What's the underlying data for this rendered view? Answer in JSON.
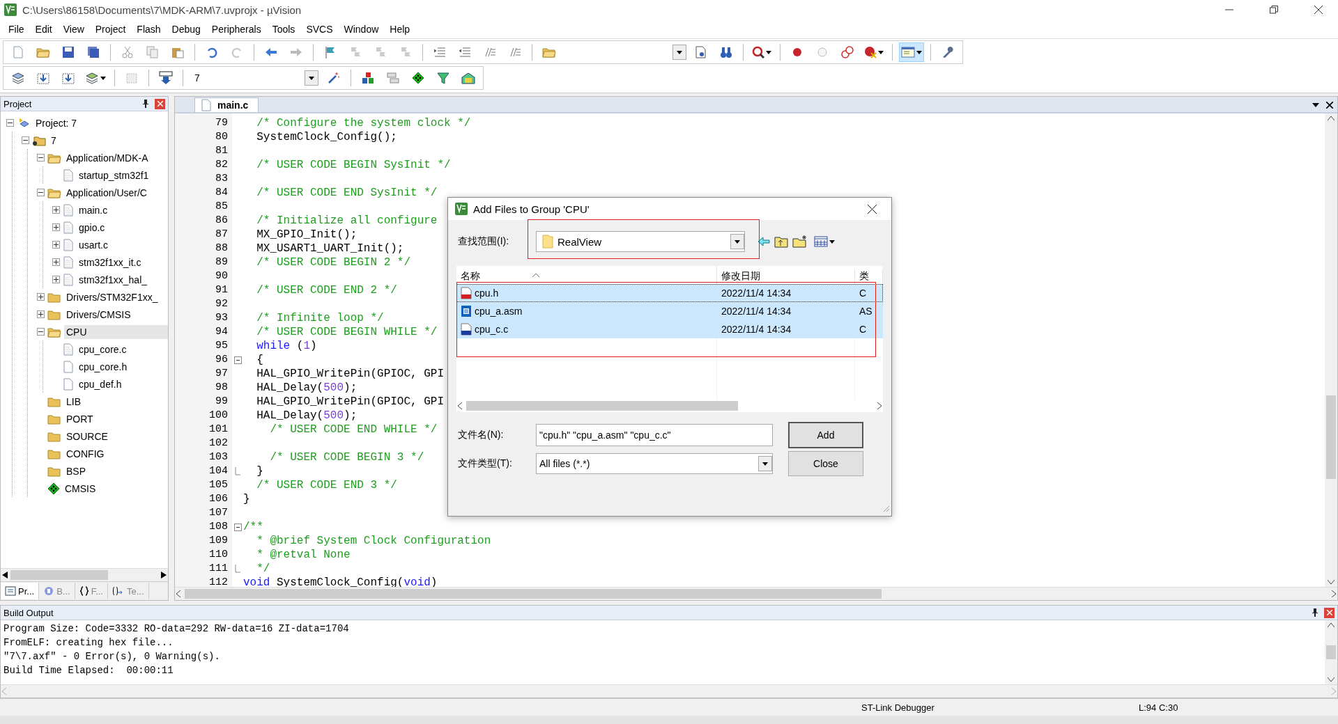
{
  "window": {
    "title": "C:\\Users\\86158\\Documents\\7\\MDK-ARM\\7.uvprojx - µVision"
  },
  "menu": [
    "File",
    "Edit",
    "View",
    "Project",
    "Flash",
    "Debug",
    "Peripherals",
    "Tools",
    "SVCS",
    "Window",
    "Help"
  ],
  "toolbar": {
    "window_toggle": {
      "selected": true
    },
    "target": {
      "value": "7"
    }
  },
  "project_panel": {
    "title": "Project",
    "tree": [
      {
        "label": "Project: 7",
        "kind": "project",
        "expanded": true,
        "selected": false,
        "children": [
          {
            "label": "7",
            "kind": "target",
            "expanded": true,
            "selected": false,
            "children": [
              {
                "label": "Application/MDK-A",
                "kind": "folder",
                "expanded": true,
                "selected": false,
                "children": [
                  {
                    "label": "startup_stm32f1",
                    "kind": "source",
                    "selected": false
                  }
                ]
              },
              {
                "label": "Application/User/C",
                "kind": "folder",
                "expanded": true,
                "selected": false,
                "children": [
                  {
                    "label": "main.c",
                    "kind": "source",
                    "expanded": false,
                    "selected": false
                  },
                  {
                    "label": "gpio.c",
                    "kind": "source",
                    "expanded": false,
                    "selected": false
                  },
                  {
                    "label": "usart.c",
                    "kind": "source",
                    "expanded": false,
                    "selected": false
                  },
                  {
                    "label": "stm32f1xx_it.c",
                    "kind": "source",
                    "expanded": false,
                    "selected": false
                  },
                  {
                    "label": "stm32f1xx_hal_",
                    "kind": "source",
                    "expanded": false,
                    "selected": false
                  }
                ]
              },
              {
                "label": "Drivers/STM32F1xx_",
                "kind": "folder",
                "expanded": false,
                "selected": false
              },
              {
                "label": "Drivers/CMSIS",
                "kind": "folder",
                "expanded": false,
                "selected": false
              },
              {
                "label": "CPU",
                "kind": "folder",
                "expanded": true,
                "selected": true,
                "children": [
                  {
                    "label": "cpu_core.c",
                    "kind": "source",
                    "selected": false
                  },
                  {
                    "label": "cpu_core.h",
                    "kind": "header",
                    "selected": false
                  },
                  {
                    "label": "cpu_def.h",
                    "kind": "header",
                    "selected": false
                  }
                ]
              },
              {
                "label": "LIB",
                "kind": "folder",
                "selected": false
              },
              {
                "label": "PORT",
                "kind": "folder",
                "selected": false
              },
              {
                "label": "SOURCE",
                "kind": "folder",
                "selected": false
              },
              {
                "label": "CONFIG",
                "kind": "folder",
                "selected": false
              },
              {
                "label": "BSP",
                "kind": "folder",
                "selected": false
              },
              {
                "label": "CMSIS",
                "kind": "component",
                "selected": false
              }
            ]
          }
        ]
      }
    ],
    "tabs": [
      {
        "label": "Pr...",
        "kind": "project",
        "selected": true
      },
      {
        "label": "B...",
        "kind": "books",
        "selected": false
      },
      {
        "label": "F...",
        "kind": "functions",
        "selected": false
      },
      {
        "label": "Te...",
        "kind": "templates",
        "selected": false
      }
    ]
  },
  "editor": {
    "tabs": [
      {
        "label": "main.c",
        "selected": true
      }
    ],
    "lines": [
      {
        "number": "79",
        "tokens": [
          {
            "kind": "comment",
            "text": "  /* Configure the system clock */"
          }
        ]
      },
      {
        "number": "80",
        "tokens": [
          {
            "kind": "code",
            "text": "  SystemClock_Config();"
          }
        ]
      },
      {
        "number": "81"
      },
      {
        "number": "82",
        "tokens": [
          {
            "kind": "comment",
            "text": "  /* USER CODE BEGIN SysInit */"
          }
        ]
      },
      {
        "number": "83"
      },
      {
        "number": "84",
        "tokens": [
          {
            "kind": "comment",
            "text": "  /* USER CODE END SysInit */"
          }
        ]
      },
      {
        "number": "85"
      },
      {
        "number": "86",
        "tokens": [
          {
            "kind": "comment",
            "text": "  /* Initialize all configure"
          }
        ]
      },
      {
        "number": "87",
        "tokens": [
          {
            "kind": "code",
            "text": "  MX_GPIO_Init();"
          }
        ]
      },
      {
        "number": "88",
        "tokens": [
          {
            "kind": "code",
            "text": "  MX_USART1_UART_Init();"
          }
        ]
      },
      {
        "number": "89",
        "tokens": [
          {
            "kind": "comment",
            "text": "  /* USER CODE BEGIN 2 */"
          }
        ]
      },
      {
        "number": "90"
      },
      {
        "number": "91",
        "tokens": [
          {
            "kind": "comment",
            "text": "  /* USER CODE END 2 */"
          }
        ]
      },
      {
        "number": "92"
      },
      {
        "number": "93",
        "tokens": [
          {
            "kind": "comment",
            "text": "  /* Infinite loop */"
          }
        ]
      },
      {
        "number": "94",
        "tokens": [
          {
            "kind": "comment",
            "text": "  /* USER CODE BEGIN WHILE */"
          }
        ]
      },
      {
        "number": "95",
        "tokens": [
          {
            "kind": "keyword",
            "text": "  while"
          },
          {
            "kind": "code",
            "text": " ("
          },
          {
            "kind": "number",
            "text": "1"
          },
          {
            "kind": "code",
            "text": ")"
          }
        ]
      },
      {
        "number": "96",
        "fold_start": true,
        "tokens": [
          {
            "kind": "code",
            "text": "  {"
          }
        ]
      },
      {
        "number": "97",
        "tokens": [
          {
            "kind": "code",
            "text": "  HAL_GPIO_WritePin(GPIOC, GPI"
          }
        ]
      },
      {
        "number": "98",
        "tokens": [
          {
            "kind": "code",
            "text": "  HAL_Delay("
          },
          {
            "kind": "number",
            "text": "500"
          },
          {
            "kind": "code",
            "text": ");"
          }
        ]
      },
      {
        "number": "99",
        "tokens": [
          {
            "kind": "code",
            "text": "  HAL_GPIO_WritePin(GPIOC, GPI"
          }
        ]
      },
      {
        "number": "100",
        "tokens": [
          {
            "kind": "code",
            "text": "  HAL_Delay("
          },
          {
            "kind": "number",
            "text": "500"
          },
          {
            "kind": "code",
            "text": ");"
          }
        ]
      },
      {
        "number": "101",
        "tokens": [
          {
            "kind": "comment",
            "text": "    /* USER CODE END WHILE */"
          }
        ]
      },
      {
        "number": "102"
      },
      {
        "number": "103",
        "tokens": [
          {
            "kind": "comment",
            "text": "    /* USER CODE BEGIN 3 */"
          }
        ]
      },
      {
        "number": "104",
        "fold_end": true,
        "tokens": [
          {
            "kind": "code",
            "text": "  }"
          }
        ]
      },
      {
        "number": "105",
        "tokens": [
          {
            "kind": "comment",
            "text": "  /* USER CODE END 3 */"
          }
        ]
      },
      {
        "number": "106",
        "tokens": [
          {
            "kind": "code",
            "text": "}"
          }
        ]
      },
      {
        "number": "107"
      },
      {
        "number": "108",
        "fold_start": true,
        "tokens": [
          {
            "kind": "comment",
            "text": "/**"
          }
        ]
      },
      {
        "number": "109",
        "tokens": [
          {
            "kind": "comment",
            "text": "  * @brief System Clock Configuration"
          }
        ]
      },
      {
        "number": "110",
        "tokens": [
          {
            "kind": "comment",
            "text": "  * @retval None"
          }
        ]
      },
      {
        "number": "111",
        "fold_end": true,
        "tokens": [
          {
            "kind": "comment",
            "text": "  */"
          }
        ]
      },
      {
        "number": "112",
        "tokens": [
          {
            "kind": "keyword",
            "text": "void"
          },
          {
            "kind": "code",
            "text": " SystemClock_Config("
          },
          {
            "kind": "keyword",
            "text": "void"
          },
          {
            "kind": "code",
            "text": ")"
          }
        ]
      }
    ]
  },
  "dialog": {
    "title": "Add Files to Group 'CPU'",
    "look_in_label": "查找范围(I):",
    "look_in": "RealView",
    "columns": [
      "名称",
      "修改日期",
      "类"
    ],
    "files": [
      {
        "name": "cpu.h",
        "kind": "header",
        "date": "2022/11/4 14:34",
        "type": "C",
        "selected": true
      },
      {
        "name": "cpu_a.asm",
        "kind": "asm",
        "date": "2022/11/4 14:34",
        "type": "AS",
        "selected": true
      },
      {
        "name": "cpu_c.c",
        "kind": "source",
        "date": "2022/11/4 14:34",
        "type": "C",
        "selected": true
      }
    ],
    "file_name_label": "文件名(N):",
    "file_name": "\"cpu.h\" \"cpu_a.asm\" \"cpu_c.c\"",
    "file_type_label": "文件类型(T):",
    "file_type": "All files (*.*)",
    "buttons": [
      "Add",
      "Close"
    ]
  },
  "build_output": {
    "title": "Build Output",
    "lines": [
      "Program Size: Code=3332 RO-data=292 RW-data=16 ZI-data=1704",
      "FromELF: creating hex file...",
      "\"7\\7.axf\" - 0 Error(s), 0 Warning(s).",
      "Build Time Elapsed:  00:00:11"
    ]
  },
  "status_bar": {
    "debugger": "ST-Link Debugger",
    "position": "L:94 C:30"
  }
}
